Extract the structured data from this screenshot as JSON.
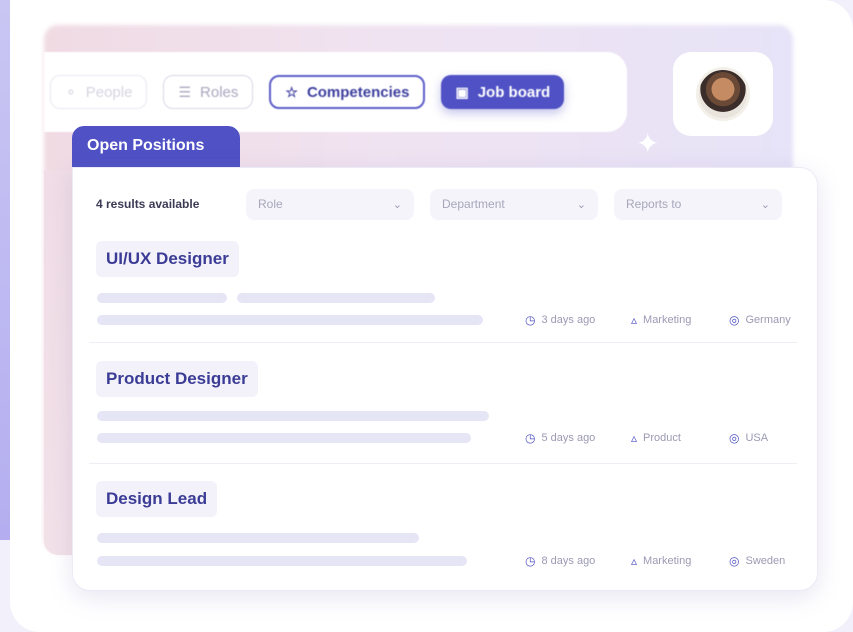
{
  "tabs": [
    {
      "label": "People",
      "icon": "person-icon"
    },
    {
      "label": "Roles",
      "icon": "roles-icon"
    },
    {
      "label": "Competencies",
      "icon": "star-icon"
    },
    {
      "label": "Job board",
      "icon": "briefcase-icon"
    }
  ],
  "section": {
    "title": "Open Positions"
  },
  "filters": {
    "results": "4 results available",
    "role": "Role",
    "department": "Department",
    "reports_to": "Reports to"
  },
  "jobs": [
    {
      "title": "UI/UX Designer",
      "posted": "3 days ago",
      "department": "Marketing",
      "location": "Germany"
    },
    {
      "title": "Product Designer",
      "posted": "5 days ago",
      "department": "Product",
      "location": "USA"
    },
    {
      "title": "Design Lead",
      "posted": "8 days ago",
      "department": "Marketing",
      "location": "Sweden"
    }
  ],
  "colors": {
    "accent": "#4f51c4",
    "background": "#f2f1fb"
  }
}
